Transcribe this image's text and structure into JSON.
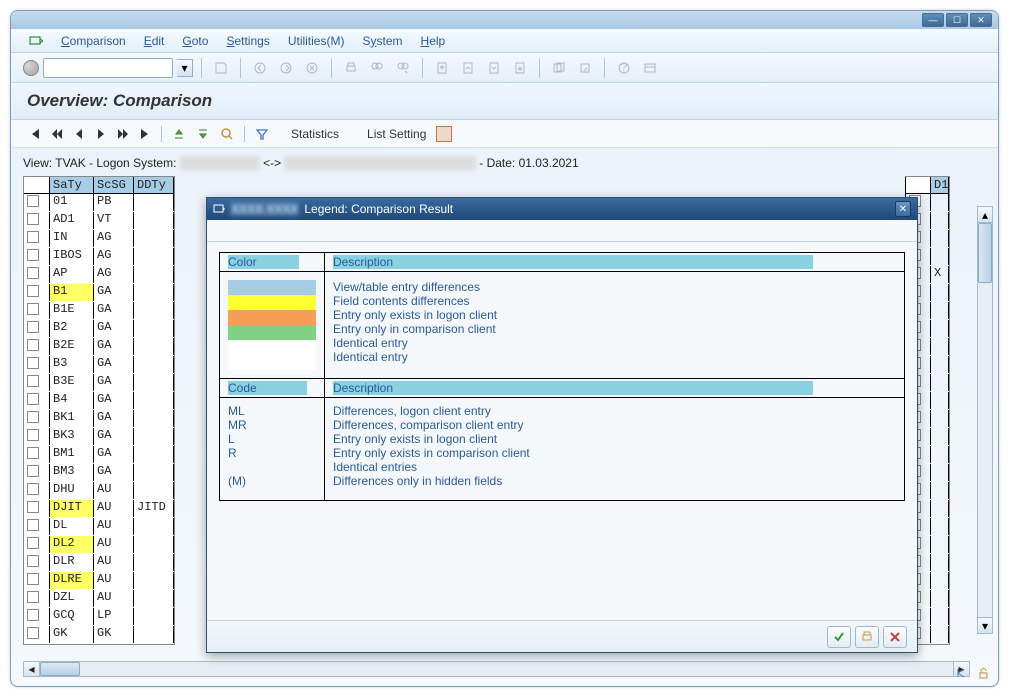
{
  "menu": {
    "comparison": "Comparison",
    "edit": "Edit",
    "goto": "Goto",
    "settings": "Settings",
    "utilities": "Utilities(M)",
    "system": "System",
    "help": "Help"
  },
  "page_title": "Overview: Comparison",
  "subtoolbar": {
    "statistics": "Statistics",
    "list_setting": "List Setting"
  },
  "info": {
    "prefix": "View: TVAK - Logon System: ",
    "sep": " <-> ",
    "date_prefix": " - Date: ",
    "date": "01.03.2021"
  },
  "grid": {
    "headers": [
      "SaTy",
      "ScSG",
      "DDTy",
      "",
      "D1"
    ],
    "rightX": "X",
    "rows": [
      {
        "c1": "01",
        "c2": "PB",
        "c3": "",
        "hl": ""
      },
      {
        "c1": "AD1",
        "c2": "VT",
        "c3": "",
        "hl": ""
      },
      {
        "c1": "IN",
        "c2": "AG",
        "c3": "",
        "hl": ""
      },
      {
        "c1": "IBOS",
        "c2": "AG",
        "c3": "",
        "hl": ""
      },
      {
        "c1": "AP",
        "c2": "AG",
        "c3": "",
        "hl": ""
      },
      {
        "c1": "B1",
        "c2": "GA",
        "c3": "",
        "hl": "yellow"
      },
      {
        "c1": "B1E",
        "c2": "GA",
        "c3": "",
        "hl": ""
      },
      {
        "c1": "B2",
        "c2": "GA",
        "c3": "",
        "hl": ""
      },
      {
        "c1": "B2E",
        "c2": "GA",
        "c3": "",
        "hl": ""
      },
      {
        "c1": "B3",
        "c2": "GA",
        "c3": "",
        "hl": ""
      },
      {
        "c1": "B3E",
        "c2": "GA",
        "c3": "",
        "hl": ""
      },
      {
        "c1": "B4",
        "c2": "GA",
        "c3": "",
        "hl": ""
      },
      {
        "c1": "BK1",
        "c2": "GA",
        "c3": "",
        "hl": ""
      },
      {
        "c1": "BK3",
        "c2": "GA",
        "c3": "",
        "hl": ""
      },
      {
        "c1": "BM1",
        "c2": "GA",
        "c3": "",
        "hl": ""
      },
      {
        "c1": "BM3",
        "c2": "GA",
        "c3": "",
        "hl": ""
      },
      {
        "c1": "DHU",
        "c2": "AU",
        "c3": "",
        "hl": ""
      },
      {
        "c1": "DJIT",
        "c2": "AU",
        "c3": "JITD",
        "hl": "yellow"
      },
      {
        "c1": "DL",
        "c2": "AU",
        "c3": "",
        "hl": ""
      },
      {
        "c1": "DL2",
        "c2": "AU",
        "c3": "",
        "hl": "yellow"
      },
      {
        "c1": "DLR",
        "c2": "AU",
        "c3": "",
        "hl": ""
      },
      {
        "c1": "DLRE",
        "c2": "AU",
        "c3": "",
        "hl": "yellow"
      },
      {
        "c1": "DZL",
        "c2": "AU",
        "c3": "",
        "hl": ""
      },
      {
        "c1": "GCQ",
        "c2": "LP",
        "c3": "",
        "hl": ""
      },
      {
        "c1": "GK",
        "c2": "GK",
        "c3": "",
        "hl": ""
      }
    ]
  },
  "legend": {
    "title": "Legend: Comparison Result",
    "hdr_color": "Color",
    "hdr_desc": "Description",
    "hdr_code": "Code",
    "colors": [
      {
        "cls": "sw-blue",
        "desc": "View/table entry differences"
      },
      {
        "cls": "sw-yellow",
        "desc": "Field contents differences"
      },
      {
        "cls": "sw-orange",
        "desc": "Entry only exists in logon client"
      },
      {
        "cls": "sw-green",
        "desc": "Entry only in comparison client"
      },
      {
        "cls": "sw-white",
        "desc": "Identical entry"
      },
      {
        "cls": "sw-white",
        "desc": "Identical entry"
      }
    ],
    "codes": [
      {
        "code": "ML",
        "desc": "Differences, logon client entry"
      },
      {
        "code": "MR",
        "desc": "Differences, comparison client entry"
      },
      {
        "code": "L",
        "desc": "Entry only exists in logon client"
      },
      {
        "code": "R",
        "desc": "Entry only exists in comparison client"
      },
      {
        "code": "",
        "desc": "Identical entries"
      },
      {
        "code": "(M)",
        "desc": "Differences only in hidden fields"
      }
    ]
  }
}
